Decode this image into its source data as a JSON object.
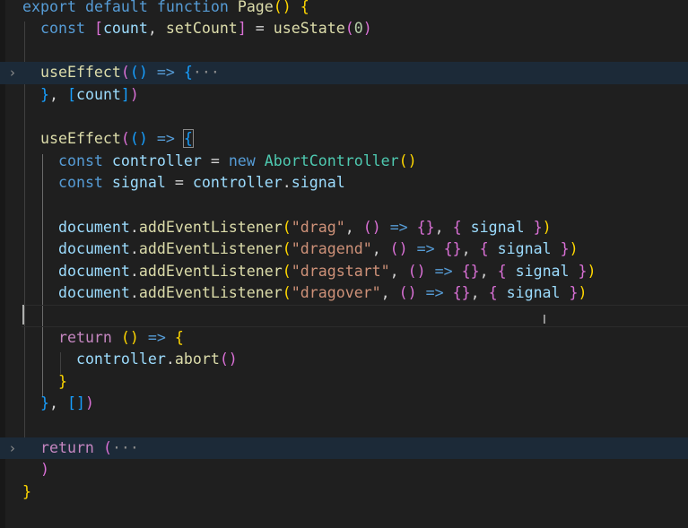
{
  "editor": {
    "language": "tsx",
    "fold_chevron": "›",
    "lines": [
      [
        [
          "kw",
          "export"
        ],
        [
          "txt",
          " "
        ],
        [
          "kw",
          "default"
        ],
        [
          "txt",
          " "
        ],
        [
          "kw",
          "function"
        ],
        [
          "txt",
          " "
        ],
        [
          "fn",
          "Page"
        ],
        [
          "p1",
          "()"
        ],
        [
          "txt",
          " "
        ],
        [
          "p1",
          "{"
        ]
      ],
      [
        [
          "txt",
          "  "
        ],
        [
          "kw",
          "const"
        ],
        [
          "txt",
          " "
        ],
        [
          "p2",
          "["
        ],
        [
          "var",
          "count"
        ],
        [
          "txt",
          ", "
        ],
        [
          "fn",
          "setCount"
        ],
        [
          "p2",
          "]"
        ],
        [
          "txt",
          " = "
        ],
        [
          "fn",
          "useState"
        ],
        [
          "p2",
          "("
        ],
        [
          "num",
          "0"
        ],
        [
          "p2",
          ")"
        ]
      ],
      [],
      [
        [
          "txt",
          "  "
        ],
        [
          "fn",
          "useEffect"
        ],
        [
          "p2",
          "("
        ],
        [
          "p3",
          "()"
        ],
        [
          "txt",
          " "
        ],
        [
          "kw",
          "=>"
        ],
        [
          "txt",
          " "
        ],
        [
          "p3",
          "{"
        ],
        [
          "ell",
          "···"
        ]
      ],
      [
        [
          "txt",
          "  "
        ],
        [
          "p3",
          "}"
        ],
        [
          "txt",
          ", "
        ],
        [
          "p3",
          "["
        ],
        [
          "var",
          "count"
        ],
        [
          "p3",
          "]"
        ],
        [
          "p2",
          ")"
        ]
      ],
      [],
      [
        [
          "txt",
          "  "
        ],
        [
          "fn",
          "useEffect"
        ],
        [
          "p2",
          "("
        ],
        [
          "p3",
          "()"
        ],
        [
          "txt",
          " "
        ],
        [
          "kw",
          "=>"
        ],
        [
          "txt",
          " "
        ],
        [
          "p3",
          "{"
        ]
      ],
      [
        [
          "txt",
          "    "
        ],
        [
          "kw",
          "const"
        ],
        [
          "txt",
          " "
        ],
        [
          "var",
          "controller"
        ],
        [
          "txt",
          " = "
        ],
        [
          "kw",
          "new"
        ],
        [
          "txt",
          " "
        ],
        [
          "cls",
          "AbortController"
        ],
        [
          "p1",
          "()"
        ]
      ],
      [
        [
          "txt",
          "    "
        ],
        [
          "kw",
          "const"
        ],
        [
          "txt",
          " "
        ],
        [
          "var",
          "signal"
        ],
        [
          "txt",
          " = "
        ],
        [
          "var",
          "controller"
        ],
        [
          "txt",
          "."
        ],
        [
          "var",
          "signal"
        ]
      ],
      [],
      [
        [
          "txt",
          "    "
        ],
        [
          "var",
          "document"
        ],
        [
          "txt",
          "."
        ],
        [
          "fn",
          "addEventListener"
        ],
        [
          "p1",
          "("
        ],
        [
          "str",
          "\"drag\""
        ],
        [
          "txt",
          ", "
        ],
        [
          "p2",
          "()"
        ],
        [
          "txt",
          " "
        ],
        [
          "kw",
          "=>"
        ],
        [
          "txt",
          " "
        ],
        [
          "p2",
          "{}"
        ],
        [
          "txt",
          ", "
        ],
        [
          "p2",
          "{"
        ],
        [
          "txt",
          " "
        ],
        [
          "var",
          "signal"
        ],
        [
          "txt",
          " "
        ],
        [
          "p2",
          "}"
        ],
        [
          "p1",
          ")"
        ]
      ],
      [
        [
          "txt",
          "    "
        ],
        [
          "var",
          "document"
        ],
        [
          "txt",
          "."
        ],
        [
          "fn",
          "addEventListener"
        ],
        [
          "p1",
          "("
        ],
        [
          "str",
          "\"dragend\""
        ],
        [
          "txt",
          ", "
        ],
        [
          "p2",
          "()"
        ],
        [
          "txt",
          " "
        ],
        [
          "kw",
          "=>"
        ],
        [
          "txt",
          " "
        ],
        [
          "p2",
          "{}"
        ],
        [
          "txt",
          ", "
        ],
        [
          "p2",
          "{"
        ],
        [
          "txt",
          " "
        ],
        [
          "var",
          "signal"
        ],
        [
          "txt",
          " "
        ],
        [
          "p2",
          "}"
        ],
        [
          "p1",
          ")"
        ]
      ],
      [
        [
          "txt",
          "    "
        ],
        [
          "var",
          "document"
        ],
        [
          "txt",
          "."
        ],
        [
          "fn",
          "addEventListener"
        ],
        [
          "p1",
          "("
        ],
        [
          "str",
          "\"dragstart\""
        ],
        [
          "txt",
          ", "
        ],
        [
          "p2",
          "()"
        ],
        [
          "txt",
          " "
        ],
        [
          "kw",
          "=>"
        ],
        [
          "txt",
          " "
        ],
        [
          "p2",
          "{}"
        ],
        [
          "txt",
          ", "
        ],
        [
          "p2",
          "{"
        ],
        [
          "txt",
          " "
        ],
        [
          "var",
          "signal"
        ],
        [
          "txt",
          " "
        ],
        [
          "p2",
          "}"
        ],
        [
          "p1",
          ")"
        ]
      ],
      [
        [
          "txt",
          "    "
        ],
        [
          "var",
          "document"
        ],
        [
          "txt",
          "."
        ],
        [
          "fn",
          "addEventListener"
        ],
        [
          "p1",
          "("
        ],
        [
          "str",
          "\"dragover\""
        ],
        [
          "txt",
          ", "
        ],
        [
          "p2",
          "()"
        ],
        [
          "txt",
          " "
        ],
        [
          "kw",
          "=>"
        ],
        [
          "txt",
          " "
        ],
        [
          "p2",
          "{}"
        ],
        [
          "txt",
          ", "
        ],
        [
          "p2",
          "{"
        ],
        [
          "txt",
          " "
        ],
        [
          "var",
          "signal"
        ],
        [
          "txt",
          " "
        ],
        [
          "p2",
          "}"
        ],
        [
          "p1",
          ")"
        ]
      ],
      [],
      [
        [
          "txt",
          "    "
        ],
        [
          "ctl",
          "return"
        ],
        [
          "txt",
          " "
        ],
        [
          "p1",
          "()"
        ],
        [
          "txt",
          " "
        ],
        [
          "kw",
          "=>"
        ],
        [
          "txt",
          " "
        ],
        [
          "p1",
          "{"
        ]
      ],
      [
        [
          "txt",
          "      "
        ],
        [
          "var",
          "controller"
        ],
        [
          "txt",
          "."
        ],
        [
          "fn",
          "abort"
        ],
        [
          "p2",
          "()"
        ]
      ],
      [
        [
          "txt",
          "    "
        ],
        [
          "p1",
          "}"
        ]
      ],
      [
        [
          "txt",
          "  "
        ],
        [
          "p3",
          "}"
        ],
        [
          "txt",
          ", "
        ],
        [
          "p3",
          "[]"
        ],
        [
          "p2",
          ")"
        ]
      ],
      [],
      [
        [
          "txt",
          "  "
        ],
        [
          "ctl",
          "return"
        ],
        [
          "txt",
          " "
        ],
        [
          "p2",
          "("
        ],
        [
          "ell",
          "···"
        ]
      ],
      [
        [
          "txt",
          "  "
        ],
        [
          "p2",
          ")"
        ]
      ],
      [
        [
          "p1",
          "}"
        ]
      ]
    ]
  }
}
